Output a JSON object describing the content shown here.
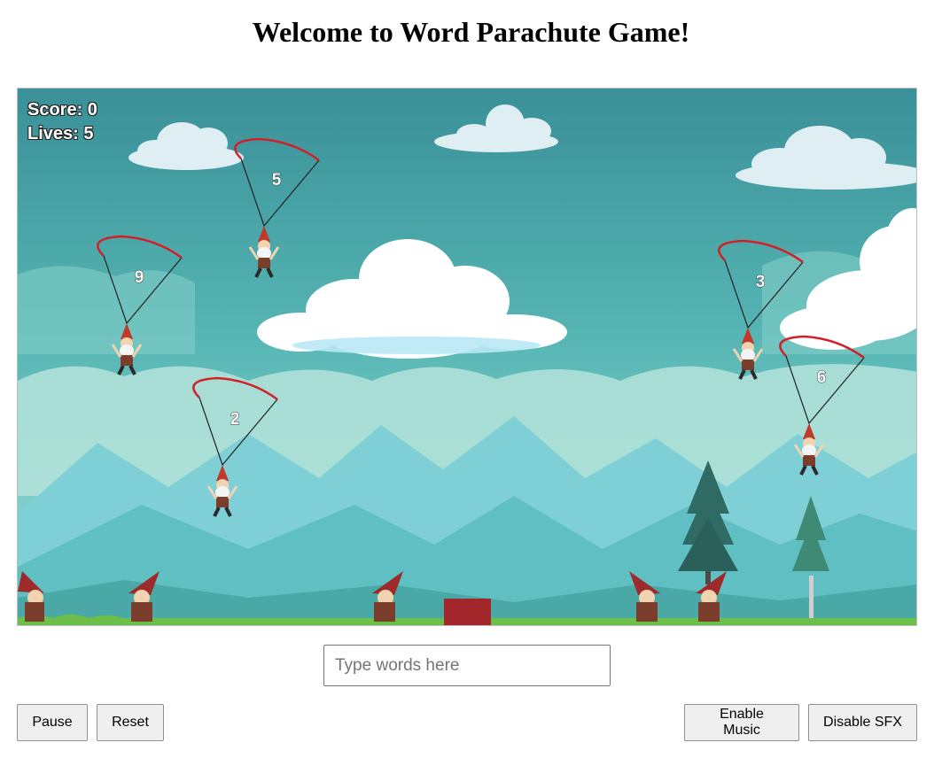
{
  "page": {
    "title": "Welcome to Word Parachute Game!"
  },
  "hud": {
    "score_label": "Score: 0",
    "lives_label": "Lives: 5"
  },
  "game": {
    "score": 0,
    "lives": 5,
    "parachutes": [
      {
        "word": "5"
      },
      {
        "word": "9"
      },
      {
        "word": "2"
      },
      {
        "word": "3"
      },
      {
        "word": "6"
      }
    ]
  },
  "input": {
    "placeholder": "Type words here",
    "value": ""
  },
  "controls": {
    "pause_label": "Pause",
    "reset_label": "Reset",
    "music_label": "Enable Music",
    "sfx_label": "Disable SFX"
  },
  "colors": {
    "sky_top": "#3a9098",
    "sky_bottom": "#8fd6d2",
    "parachute_canopy": "#d21f28",
    "ground_block": "#a3262b",
    "grass": "#6cc04a"
  }
}
